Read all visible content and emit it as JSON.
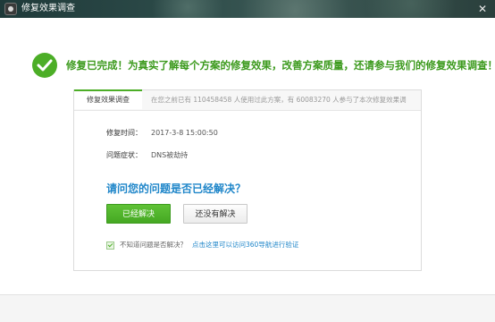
{
  "window": {
    "title": "修复效果调查",
    "close_glyph": "✕"
  },
  "hero": {
    "message": "修复已完成！为真实了解每个方案的修复效果，改善方案质量，还请参与我们的修复效果调查！"
  },
  "card": {
    "tab_label": "修复效果调查",
    "stats": "在您之前已有 110458458 人使用过此方案，有 60083270 人参与了本次修复效果调",
    "time_label": "修复时间：",
    "time_value": "2017-3-8 15:00:50",
    "symptom_label": "问题症状：",
    "symptom_value": "DNS被劫持",
    "question": "请问您的问题是否已经解决？",
    "resolved_button": "已经解决",
    "unresolved_button": "还没有解决",
    "unsure_text": "不知道问题是否解决？",
    "verify_link": "点击这里可以访问360导航进行验证",
    "unsure_checked": true
  },
  "colors": {
    "accent_green": "#4cae27",
    "link_blue": "#1f86c9"
  }
}
